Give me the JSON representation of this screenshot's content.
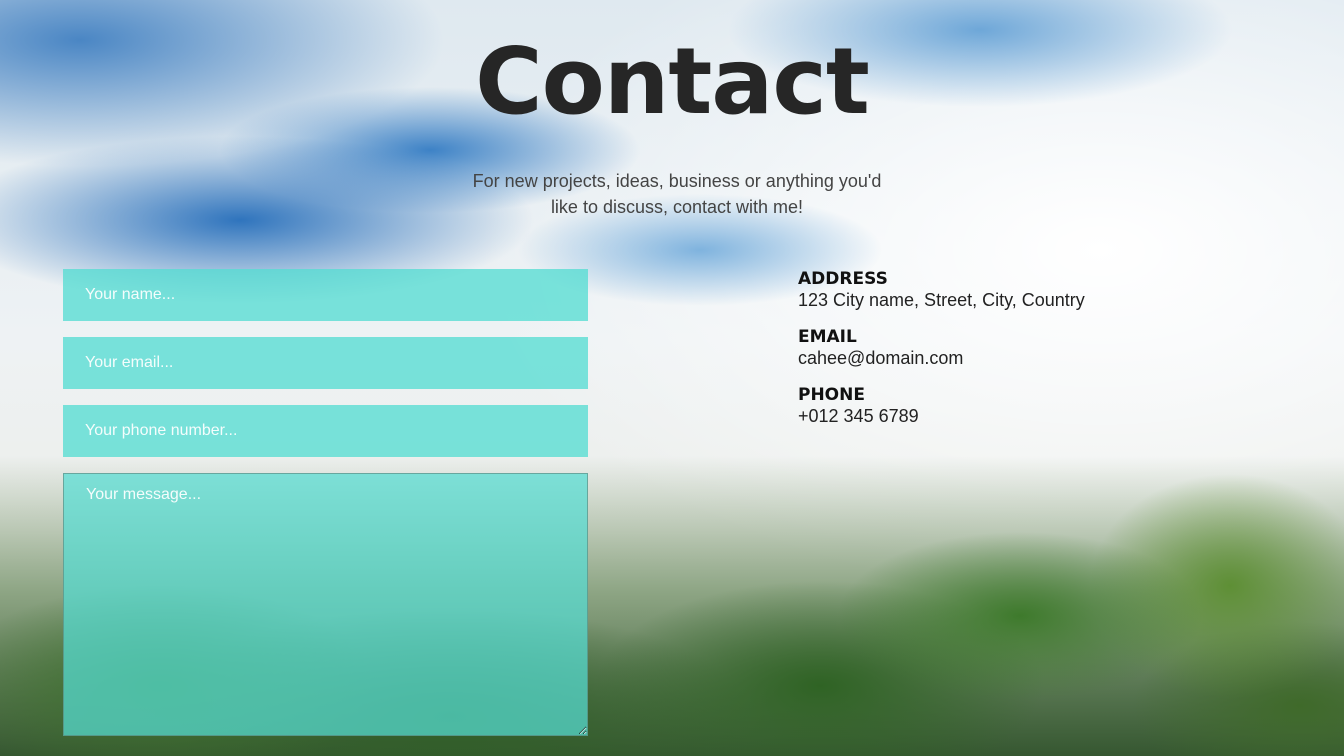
{
  "page": {
    "title": "Contact",
    "subtitle": "For new projects, ideas, business or anything you'd like to discuss, contact with me!"
  },
  "form": {
    "name_placeholder": "Your name...",
    "email_placeholder": "Your email...",
    "phone_placeholder": "Your phone number...",
    "message_placeholder": "Your message..."
  },
  "info": {
    "address_label": "ADDRESS",
    "address_value": "123 City name, Street, City, Country",
    "email_label": "EMAIL",
    "email_value": "cahee@domain.com",
    "phone_label": "PHONE",
    "phone_value": "+012 345 6789"
  },
  "colors": {
    "field_accent": "#56dcd2",
    "title_text": "#262626"
  }
}
